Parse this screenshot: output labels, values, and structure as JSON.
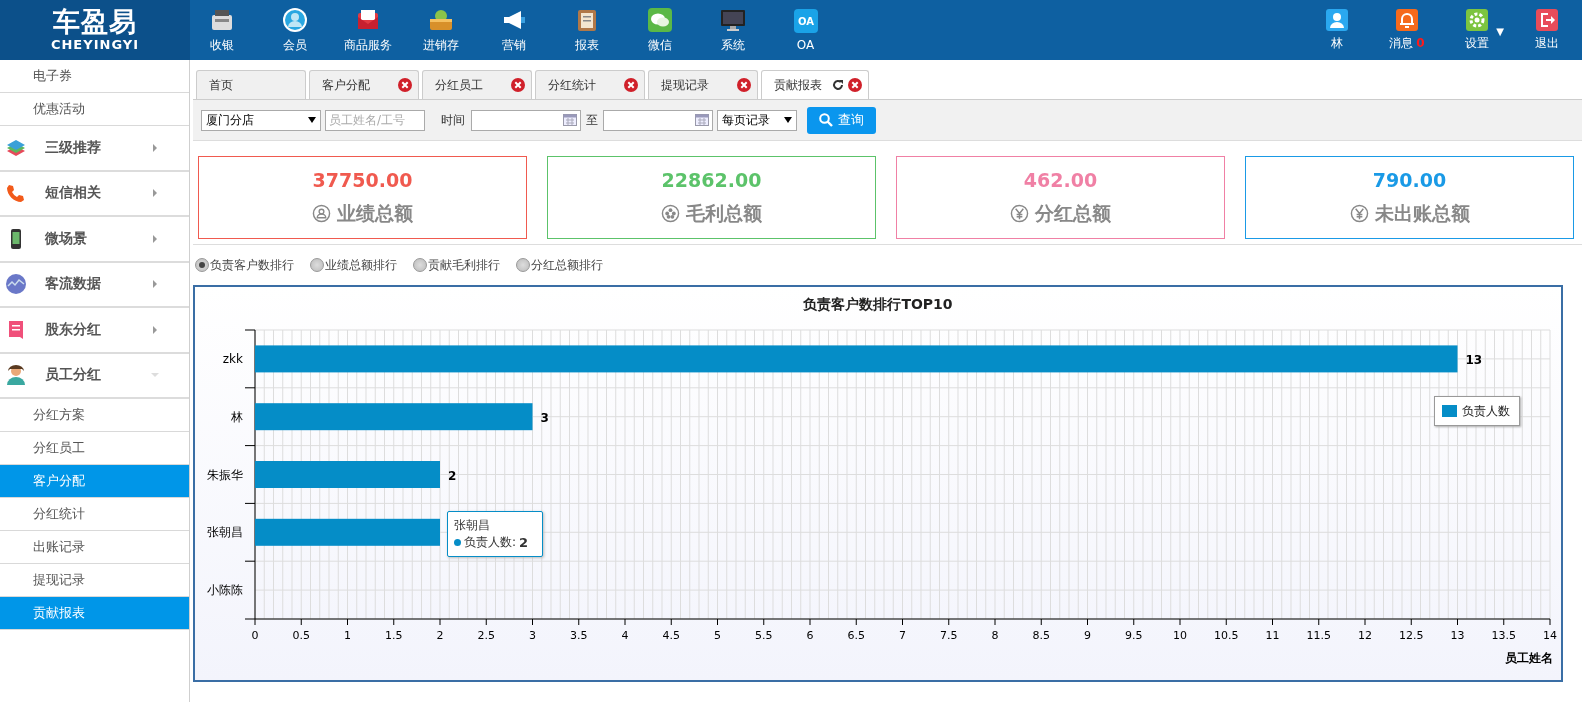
{
  "logo": {
    "name": "车盈易",
    "latin": "CHEYINGYI"
  },
  "nav": [
    {
      "label": "收银"
    },
    {
      "label": "会员"
    },
    {
      "label": "商品服务"
    },
    {
      "label": "进销存"
    },
    {
      "label": "营销"
    },
    {
      "label": "报表"
    },
    {
      "label": "微信"
    },
    {
      "label": "系统"
    },
    {
      "label": "OA",
      "badge": "OA"
    }
  ],
  "user_menu": [
    {
      "label": "林",
      "kind": "user"
    },
    {
      "label": "消息",
      "kind": "bell",
      "count": "0"
    },
    {
      "label": "设置",
      "kind": "gear",
      "caret": "▼"
    },
    {
      "label": "退出",
      "kind": "exit"
    }
  ],
  "sidebar": {
    "items": [
      {
        "label": "电子券",
        "kind": "sub",
        "selected": false
      },
      {
        "label": "优惠活动",
        "kind": "sub",
        "selected": false
      },
      {
        "label": "三级推荐",
        "kind": "group",
        "expanded": false
      },
      {
        "label": "短信相关",
        "kind": "group",
        "expanded": false
      },
      {
        "label": "微场景",
        "kind": "group",
        "expanded": false
      },
      {
        "label": "客流数据",
        "kind": "group",
        "expanded": false
      },
      {
        "label": "股东分红",
        "kind": "group",
        "expanded": false
      },
      {
        "label": "员工分红",
        "kind": "group",
        "expanded": true
      },
      {
        "label": "分红方案",
        "kind": "sub",
        "selected": false
      },
      {
        "label": "分红员工",
        "kind": "sub",
        "selected": false
      },
      {
        "label": "客户分配",
        "kind": "sub",
        "selected": true
      },
      {
        "label": "分红统计",
        "kind": "sub",
        "selected": false
      },
      {
        "label": "出账记录",
        "kind": "sub",
        "selected": false
      },
      {
        "label": "提现记录",
        "kind": "sub",
        "selected": false
      },
      {
        "label": "贡献报表",
        "kind": "sub",
        "selected": true
      }
    ]
  },
  "tabs": [
    {
      "label": "首页",
      "selected": false,
      "closable": false
    },
    {
      "label": "客户分配",
      "selected": false,
      "closable": true
    },
    {
      "label": "分红员工",
      "selected": false,
      "closable": true
    },
    {
      "label": "分红统计",
      "selected": false,
      "closable": true
    },
    {
      "label": "提现记录",
      "selected": false,
      "closable": true
    },
    {
      "label": "贡献报表",
      "selected": true,
      "closable": true
    }
  ],
  "filters": {
    "store": "厦门分店",
    "employee": {
      "placeholder": "员工姓名/工号"
    },
    "time_label": "时间",
    "range_separator": "至",
    "page_size": "每页记录",
    "search_button": "查询"
  },
  "cards": [
    {
      "value": "37750.00",
      "label": "业绩总额",
      "color": "#f05a4f"
    },
    {
      "value": "22862.00",
      "label": "毛利总额",
      "color": "#5cc36a"
    },
    {
      "value": "462.00",
      "label": "分红总额",
      "color": "#f080a5"
    },
    {
      "value": "790.00",
      "label": "未出账总额",
      "color": "#1a9ae6"
    }
  ],
  "rankings": [
    {
      "label": "负责客户数排行",
      "selected": true
    },
    {
      "label": "业绩总额排行",
      "selected": false
    },
    {
      "label": "贡献毛利排行",
      "selected": false
    },
    {
      "label": "分红总额排行",
      "selected": false
    }
  ],
  "chart": {
    "chart_data": {
      "type": "bar",
      "orientation": "horizontal",
      "title": "负责客户数排行TOP10",
      "xlabel": "员工姓名",
      "categories": [
        "zkk",
        "林",
        "朱振华",
        "张朝昌",
        "小陈陈"
      ],
      "series": [
        {
          "name": "负责人数",
          "color": "#058dc7",
          "values": [
            13,
            3,
            2,
            2,
            null
          ]
        }
      ],
      "xlim": [
        0,
        14
      ],
      "grid": true,
      "xticks": [
        0,
        0.5,
        1,
        1.5,
        2,
        2.5,
        3,
        3.5,
        4,
        4.5,
        5,
        5.5,
        6,
        6.5,
        7,
        7.5,
        8,
        8.5,
        9,
        9.5,
        10,
        10.5,
        11,
        11.5,
        12,
        12.5,
        13,
        13.5,
        14
      ],
      "value_labels": [
        "13",
        "3",
        "2",
        null,
        null
      ]
    },
    "tooltip": {
      "title": "张朝昌",
      "series": "负责人数:",
      "value": "2"
    }
  }
}
